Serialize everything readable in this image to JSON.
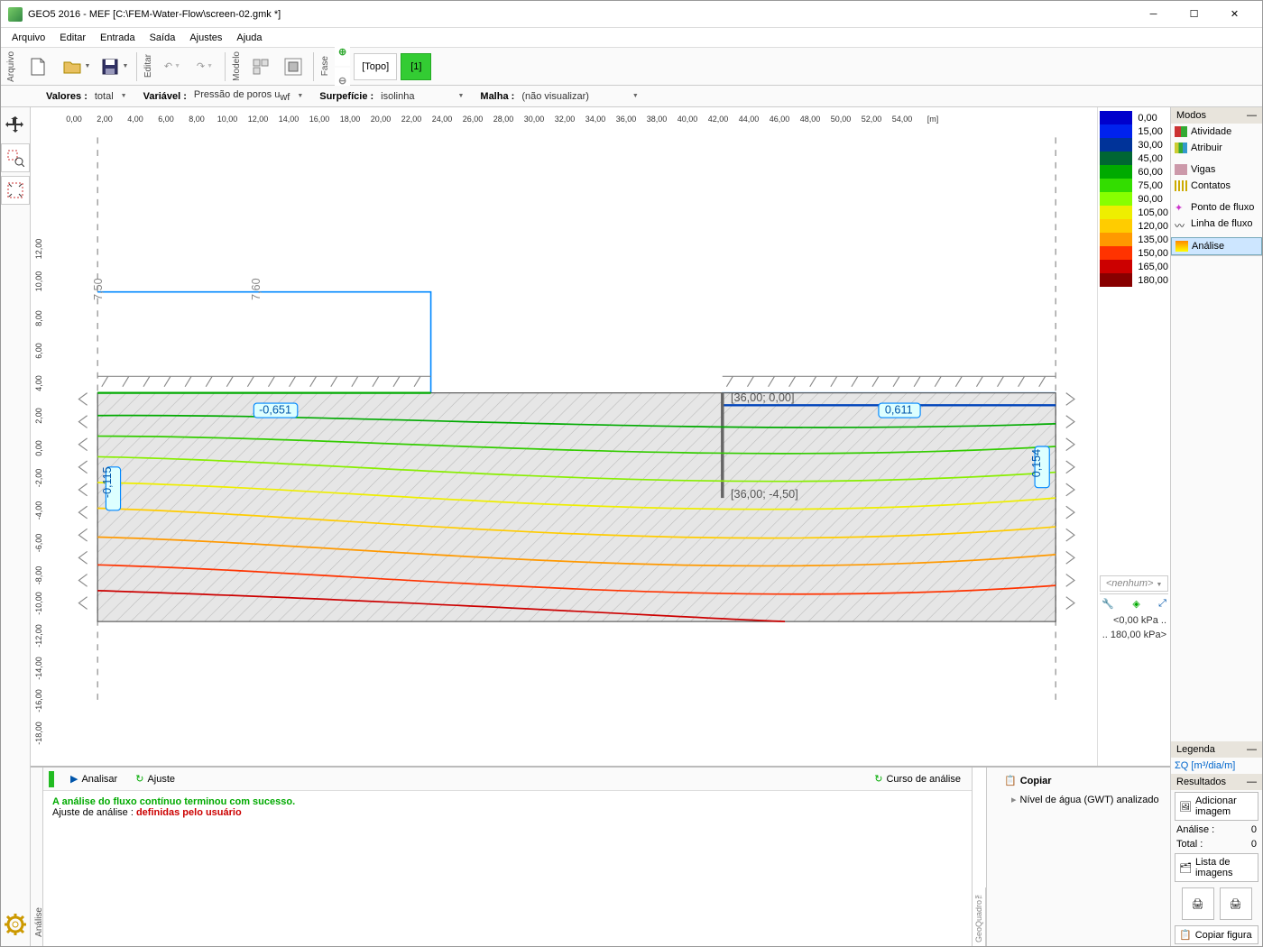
{
  "title": "GEO5 2016 - MEF [C:\\FEM-Water-Flow\\screen-02.gmk *]",
  "menu": [
    "Arquivo",
    "Editar",
    "Entrada",
    "Saída",
    "Ajustes",
    "Ajuda"
  ],
  "vlabels": {
    "arquivo": "Arquivo",
    "editar": "Editar",
    "modelo": "Modelo",
    "fase": "Fase",
    "analise": "Análise"
  },
  "stages": {
    "topo": "[Topo]",
    "one": "[1]"
  },
  "filters": {
    "valores_l": "Valores :",
    "valores_v": "total",
    "variavel_l": "Variável :",
    "variavel_v": "Pressão de poros u",
    "surp_l": "Surpefície :",
    "surp_v": "isolinha",
    "malha_l": "Malha :",
    "malha_v": "(não visualizar)"
  },
  "ruler_h": [
    "0,00",
    "2,00",
    "4,00",
    "6,00",
    "8,00",
    "10,00",
    "12,00",
    "14,00",
    "16,00",
    "18,00",
    "20,00",
    "22,00",
    "24,00",
    "26,00",
    "28,00",
    "30,00",
    "32,00",
    "34,00",
    "36,00",
    "38,00",
    "40,00",
    "42,00",
    "44,00",
    "46,00",
    "48,00",
    "50,00",
    "52,00",
    "54,00",
    "[m]"
  ],
  "ruler_v": [
    "-18,00",
    "-16,00",
    "-14,00",
    "-12,00",
    "-10,00",
    "-8,00",
    "-6,00",
    "-4,00",
    "-2,00",
    "0,00",
    "2,00",
    "4,00",
    "6,00",
    "8,00",
    "10,00",
    "12,00"
  ],
  "legend": [
    {
      "c": "#0000cc",
      "v": "0,00"
    },
    {
      "c": "#0022ee",
      "v": "15,00"
    },
    {
      "c": "#003399",
      "v": "30,00"
    },
    {
      "c": "#006633",
      "v": "45,00"
    },
    {
      "c": "#00aa00",
      "v": "60,00"
    },
    {
      "c": "#33dd00",
      "v": "75,00"
    },
    {
      "c": "#88ff00",
      "v": "90,00"
    },
    {
      "c": "#eeee00",
      "v": "105,00"
    },
    {
      "c": "#ffcc00",
      "v": "120,00"
    },
    {
      "c": "#ff9900",
      "v": "135,00"
    },
    {
      "c": "#ff3300",
      "v": "150,00"
    },
    {
      "c": "#cc0000",
      "v": "165,00"
    },
    {
      "c": "#880000",
      "v": "180,00"
    }
  ],
  "legend_none": "<nenhum>",
  "legend_range_lo": "<0,00 kPa ..",
  "legend_range_hi": ".. 180,00 kPa>",
  "modes": {
    "head": "Modos",
    "items": [
      "Atividade",
      "Atribuir",
      "Vigas",
      "Contatos",
      "Ponto de fluxo",
      "Linha de fluxo",
      "Análise"
    ]
  },
  "legenda": {
    "head": "Legenda",
    "sigma": "ΣQ [m³/dia/m]"
  },
  "resultados": {
    "head": "Resultados",
    "add": "Adicionar imagem",
    "analise_l": "Análise :",
    "analise_v": "0",
    "total_l": "Total :",
    "total_v": "0",
    "lista": "Lista de imagens",
    "copiar": "Copiar figura"
  },
  "msgbar": {
    "analisar": "Analisar",
    "ajuste": "Ajuste",
    "curso": "Curso de análise"
  },
  "msg": {
    "l1": "A análise do fluxo contínuo terminou com sucesso.",
    "l2a": "Ajuste de análise : ",
    "l2b": "definidas pelo usuário"
  },
  "copy": {
    "head": "Copiar",
    "item": "Nível de água (GWT) analizado"
  },
  "geoq": "GeoQuadro™",
  "annot": {
    "a": "-0,651",
    "b": "0,611",
    "c": "-0,115",
    "d": "0,154",
    "p1": "[36,00; 0,00]",
    "p2": "[36,00; -4,50]",
    "t1": "7,50",
    "t2": "7,60"
  },
  "chart_data": {
    "type": "contour",
    "title": "Pressão de poros u_wf (isolinha)",
    "x_range": [
      0,
      54
    ],
    "y_range": [
      -18,
      12
    ],
    "units": "m",
    "colormap_values": [
      0,
      15,
      30,
      45,
      60,
      75,
      90,
      105,
      120,
      135,
      150,
      165,
      180
    ],
    "colormap_unit": "kPa",
    "terrain": [
      [
        0,
        7.5
      ],
      [
        18,
        7.5
      ],
      [
        18,
        7.6
      ],
      [
        36,
        4.0
      ],
      [
        36,
        0.0
      ],
      [
        54,
        0.0
      ]
    ],
    "soil_box": {
      "x": [
        0,
        54
      ],
      "y": [
        -10,
        2
      ]
    },
    "sheet_pile": {
      "x": 36,
      "y": [
        0,
        -4.5
      ]
    },
    "iso_labels": [
      -0.651,
      0.611,
      -0.115,
      0.154
    ]
  }
}
